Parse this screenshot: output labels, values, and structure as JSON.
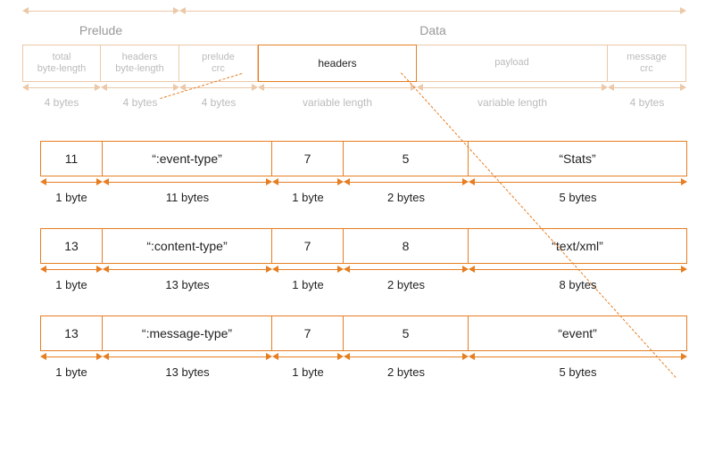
{
  "sections": {
    "prelude": "Prelude",
    "data": "Data"
  },
  "top_row": {
    "total": "total\nbyte-length",
    "headers_len": "headers\nbyte-length",
    "prelude_crc": "prelude\ncrc",
    "headers": "headers",
    "payload": "payload",
    "message_crc": "message\ncrc"
  },
  "top_sizes": {
    "total": "4 bytes",
    "headers_len": "4 bytes",
    "prelude_crc": "4 bytes",
    "headers": "variable length",
    "payload": "variable length",
    "message_crc": "4 bytes"
  },
  "header_rows": [
    {
      "cells": [
        "11",
        "“:event-type”",
        "7",
        "5",
        "“Stats”"
      ],
      "bytes": [
        "1 byte",
        "11 bytes",
        "1 byte",
        "2 bytes",
        "5 bytes"
      ]
    },
    {
      "cells": [
        "13",
        "“:content-type”",
        "7",
        "8",
        "“text/xml”"
      ],
      "bytes": [
        "1 byte",
        "13 bytes",
        "1 byte",
        "2 bytes",
        "8 bytes"
      ]
    },
    {
      "cells": [
        "13",
        "“:message-type”",
        "7",
        "5",
        "“event”"
      ],
      "bytes": [
        "1 byte",
        "13 bytes",
        "1 byte",
        "2 bytes",
        "5 bytes"
      ]
    }
  ]
}
